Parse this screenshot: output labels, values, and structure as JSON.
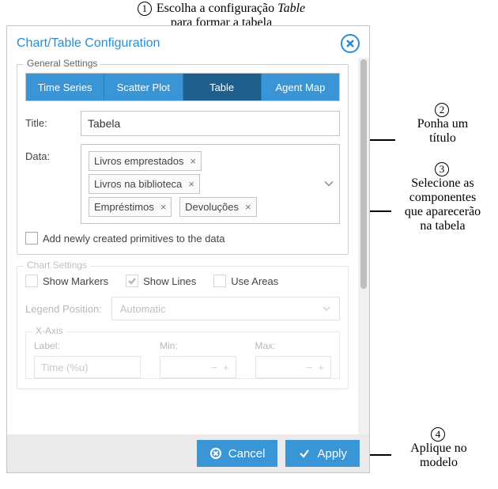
{
  "annotations": {
    "a1_pre": "Escolha a configuração",
    "a1_em": "Table",
    "a1_line2": "para formar a tabela",
    "a2_num": "2",
    "a2_l1": "Ponha um",
    "a2_l2": "título",
    "a3_num": "3",
    "a3_l1": "Selecione as",
    "a3_l2": "componentes",
    "a3_l3": "que aparecerão",
    "a3_l4": "na tabela",
    "a4_num": "4",
    "a4_l1": "Aplique no",
    "a4_l2": "modelo",
    "n1": "1"
  },
  "dialog": {
    "title": "Chart/Table Configuration"
  },
  "general": {
    "legend": "General Settings",
    "tabs": {
      "time_series": "Time Series",
      "scatter": "Scatter Plot",
      "table": "Table",
      "agent_map": "Agent Map"
    },
    "title_label": "Title:",
    "title_value": "Tabela",
    "data_label": "Data:",
    "tags": {
      "t1": "Livros emprestados",
      "t2": "Livros na biblioteca",
      "t3": "Empréstimos",
      "t4": "Devoluções",
      "x": "×"
    },
    "add_prim": "Add newly created primitives to the data"
  },
  "chart": {
    "legend": "Chart Settings",
    "show_markers": "Show Markers",
    "show_lines": "Show Lines",
    "use_areas": "Use Areas",
    "legend_pos_label": "Legend Position:",
    "legend_pos_value": "Automatic",
    "xaxis": "X-Axis",
    "label_lbl": "Label:",
    "label_val": "Time (%u)",
    "min_lbl": "Min:",
    "max_lbl": "Max:"
  },
  "footer": {
    "cancel": "Cancel",
    "apply": "Apply"
  }
}
